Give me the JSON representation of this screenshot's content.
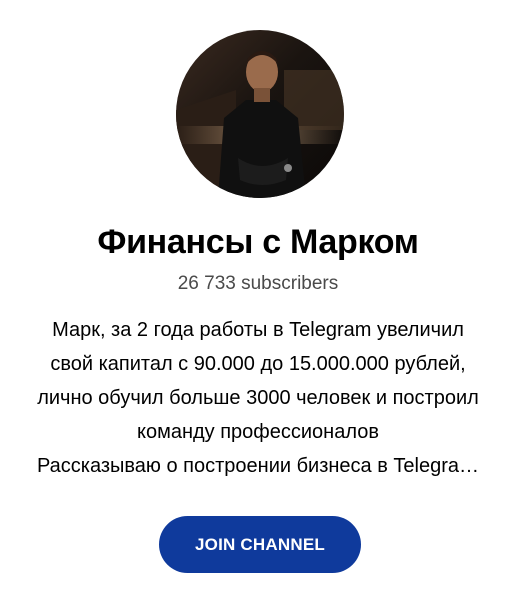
{
  "channel": {
    "title": "Финансы с Марком",
    "subscribers": "26 733 subscribers",
    "description_lines": [
      "Марк, за 2 года работы в Telegram увеличил",
      "свой капитал с 90.000 до 15.000.000 рублей,",
      "лично обучил больше 3000 человек и построил",
      "команду профессионалов",
      "Рассказываю о построении бизнеса в Telegra…"
    ],
    "avatar_icon": "channel-avatar-photo"
  },
  "actions": {
    "join_label": "JOIN CHANNEL"
  },
  "colors": {
    "button": "#0f3a9c",
    "subscribers_text": "#4a4a4a"
  }
}
